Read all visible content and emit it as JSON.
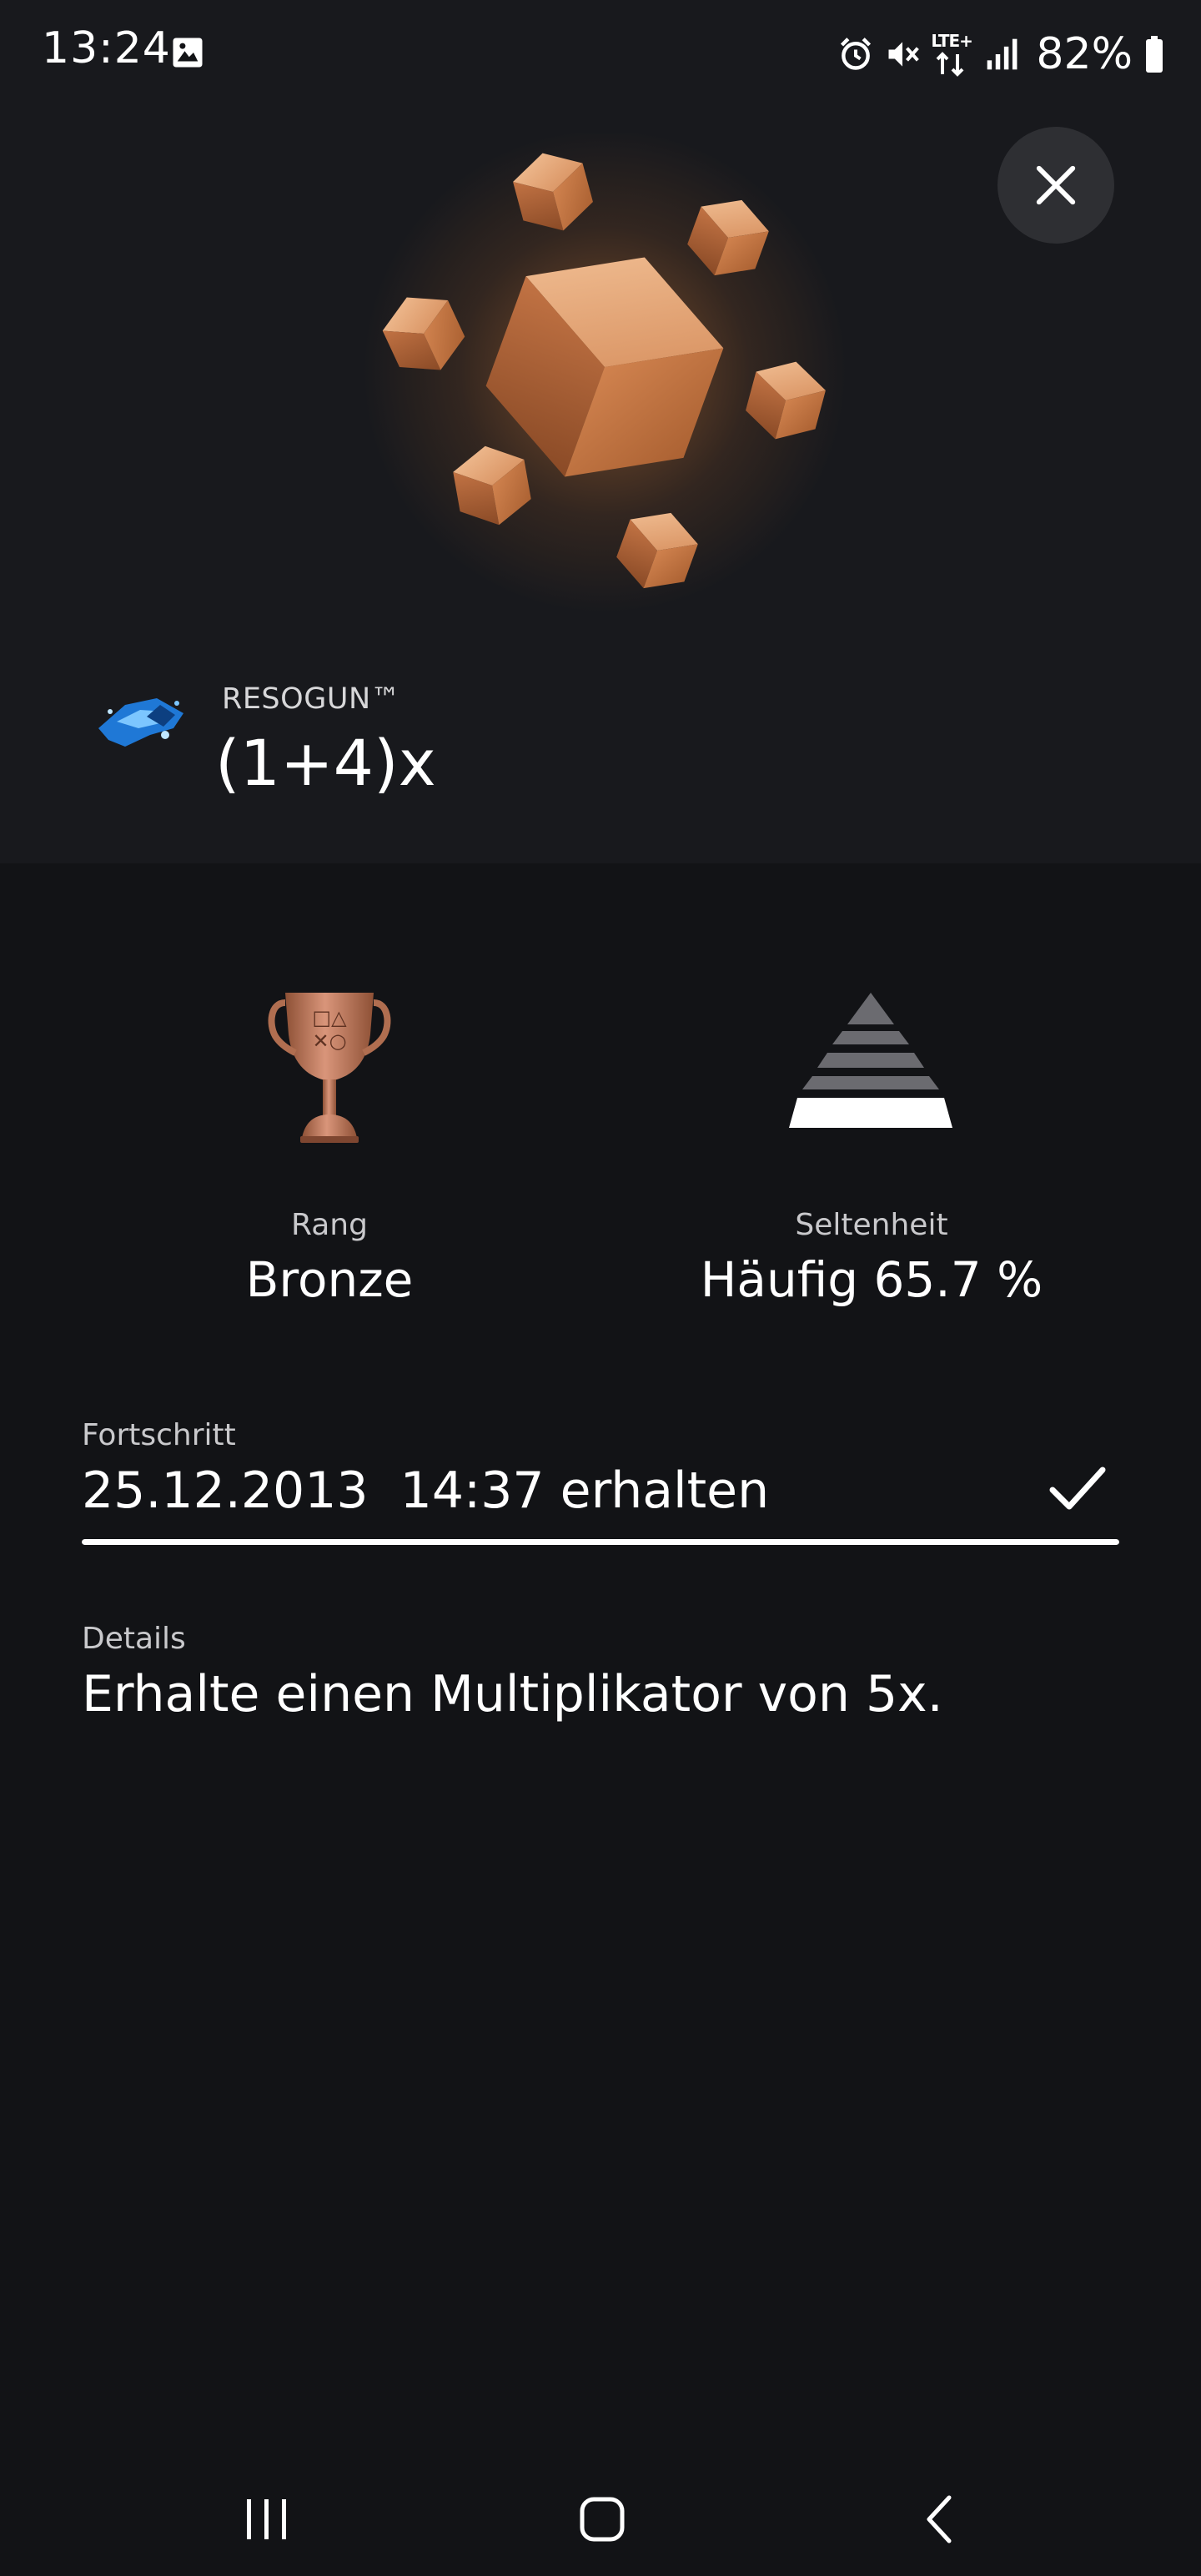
{
  "status_bar": {
    "time": "13:24",
    "battery_text": "82%",
    "network_label": "LTE+",
    "icons": [
      "image-icon",
      "alarm-icon",
      "mute-icon",
      "lte-icon",
      "signal-icon",
      "battery-icon"
    ]
  },
  "trophy": {
    "game_name": "RESOGUN™",
    "title": "(1+4)x"
  },
  "stats": {
    "rank_label": "Rang",
    "rank_value": "Bronze",
    "rarity_label": "Seltenheit",
    "rarity_value": "Häufig 65.7 %"
  },
  "progress": {
    "label": "Fortschritt",
    "value": "25.12.2013  14:37 erhalten",
    "completion": 1.0
  },
  "details": {
    "label": "Details",
    "text": "Erhalte einen Multiplikator von 5x."
  },
  "colors": {
    "background": "#121316",
    "header_background": "#18191d",
    "bronze": "#c98a60",
    "close_button": "#2e2f33"
  },
  "nav": {
    "icons": [
      "recent-apps-icon",
      "home-icon",
      "back-icon"
    ]
  }
}
